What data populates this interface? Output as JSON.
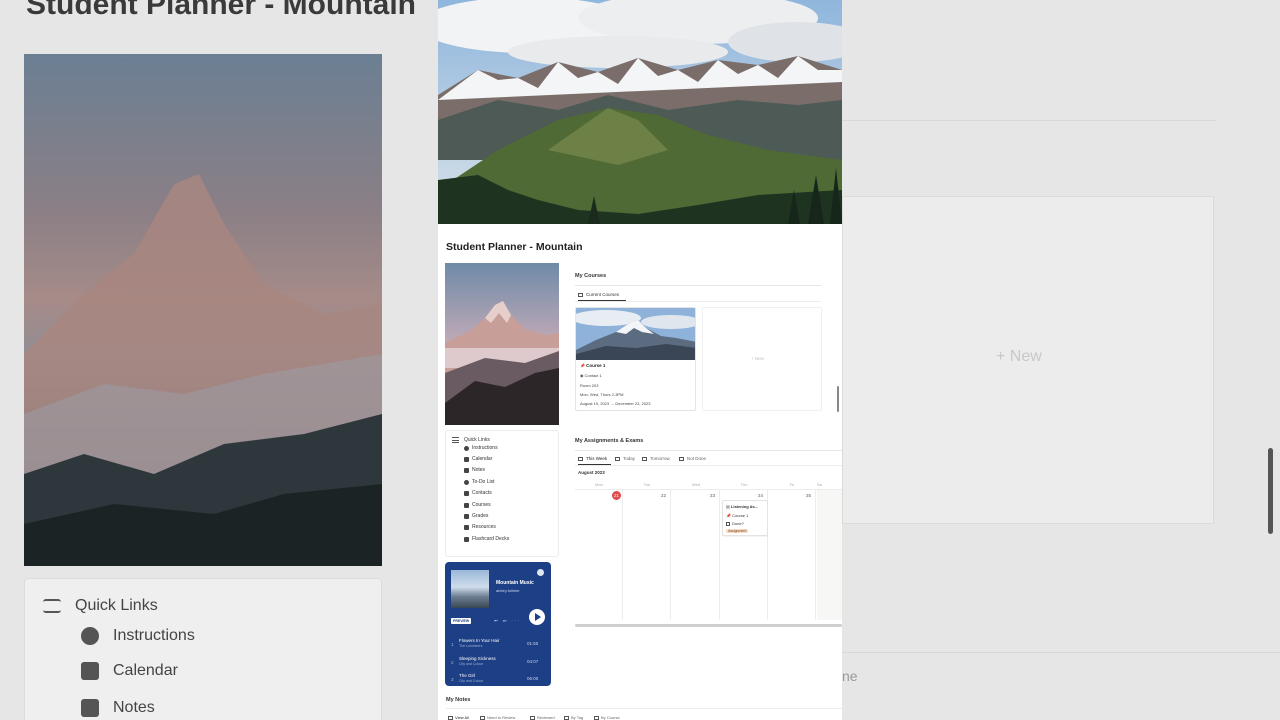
{
  "background": {
    "title": "Student Planner - Mountain",
    "quick_links_title": "Quick Links",
    "quick_links": [
      "Instructions",
      "Calendar",
      "Notes"
    ],
    "new_label": "+ New",
    "partial_text": "ne"
  },
  "page": {
    "title": "Student Planner - Mountain"
  },
  "quick_links": {
    "title": "Quick Links",
    "items": [
      {
        "label": "Instructions",
        "icon": "pin-icon"
      },
      {
        "label": "Calendar",
        "icon": "calendar-icon"
      },
      {
        "label": "Notes",
        "icon": "notes-icon"
      },
      {
        "label": "To-Do List",
        "icon": "check-circle-icon"
      },
      {
        "label": "Contacts",
        "icon": "contacts-icon"
      },
      {
        "label": "Courses",
        "icon": "grid-icon"
      },
      {
        "label": "Grades",
        "icon": "grades-icon"
      },
      {
        "label": "Resources",
        "icon": "folder-icon"
      },
      {
        "label": "Flashcard Decks",
        "icon": "cards-icon"
      }
    ]
  },
  "music": {
    "title": "Mountain Music",
    "artist": "abbey.fullmer",
    "preview_label": "PREVIEW",
    "controls": "⏮ ⏭ ···",
    "tracks": [
      {
        "n": "1",
        "title": "Flowers In Your Hair",
        "artist": "The Lumineers",
        "duration": "01:50"
      },
      {
        "n": "2",
        "title": "Sleeping Sickness",
        "artist": "City and Colour",
        "duration": "04:07"
      },
      {
        "n": "3",
        "title": "The Girl",
        "artist": "City and Colour",
        "duration": "06:00"
      }
    ],
    "colors": {
      "background": "#1d3f86"
    }
  },
  "courses": {
    "heading": "My Courses",
    "tab": "Current Courses",
    "card": {
      "name": "Course 1",
      "contact": "Contact 1",
      "room": "Room 203",
      "schedule": "Mon, Wed, Thurs 2-3PM",
      "dates": "August 19, 2023 → December 23, 2023"
    },
    "new_label": "+ New"
  },
  "assignments": {
    "heading": "My Assignments & Exams",
    "tabs": [
      "This Week",
      "Today",
      "Tomorrow",
      "Not Done"
    ],
    "month": "August 2023",
    "weekdays": [
      "Mon",
      "Tue",
      "Wed",
      "Thu",
      "Fri",
      "Sa"
    ],
    "days": [
      "21",
      "22",
      "23",
      "24",
      "25",
      ""
    ],
    "today": "21",
    "event": {
      "title": "Listening As...",
      "course": "Course 1",
      "done_label": "Done?",
      "tag": "Assignment"
    },
    "colors": {
      "today": "#e04b4b",
      "tag_bg": "#f7dcc7"
    }
  },
  "notes": {
    "heading": "My Notes",
    "tabs": [
      "View All",
      "Need to Review",
      "Reviewed",
      "By Tag",
      "By Course"
    ]
  }
}
